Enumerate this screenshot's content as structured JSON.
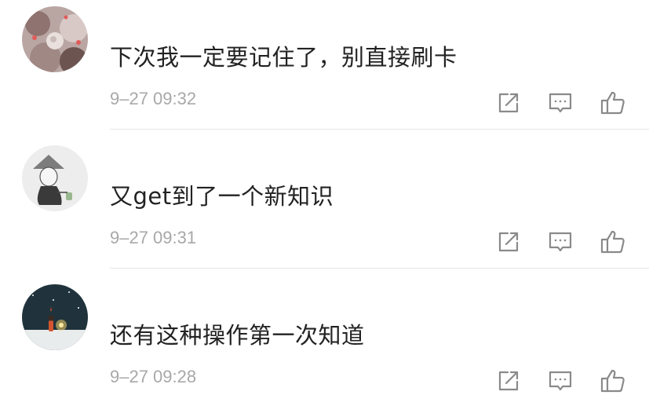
{
  "comments": [
    {
      "text": "下次我一定要记住了，别直接刷卡",
      "time": "9–27 09:32"
    },
    {
      "text": "又get到了一个新知识",
      "time": "9–27 09:31"
    },
    {
      "text": "还有这种操作第一次知道",
      "time": "9–27 09:28"
    }
  ],
  "icons": {
    "share": "share-icon",
    "reply": "comment-icon",
    "like": "thumbs-up-icon"
  },
  "colors": {
    "text": "#222222",
    "meta": "#a8a8a8",
    "icon": "#8a8a8a",
    "divider": "#e6e6e6"
  }
}
